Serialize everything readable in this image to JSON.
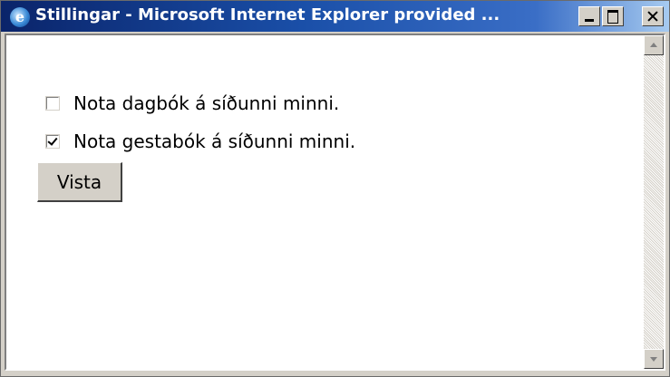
{
  "window": {
    "title": "Stillingar - Microsoft Internet Explorer provided ...",
    "icon": "internet-explorer-icon",
    "controls": [
      "minimize",
      "maximize",
      "close"
    ]
  },
  "form": {
    "options": [
      {
        "label": "Nota dagbók á síðunni minni.",
        "checked": false
      },
      {
        "label": "Nota gestabók á síðunni minni.",
        "checked": true
      }
    ],
    "submit_label": "Vista"
  },
  "scrollbar": {
    "orientation": "vertical"
  }
}
